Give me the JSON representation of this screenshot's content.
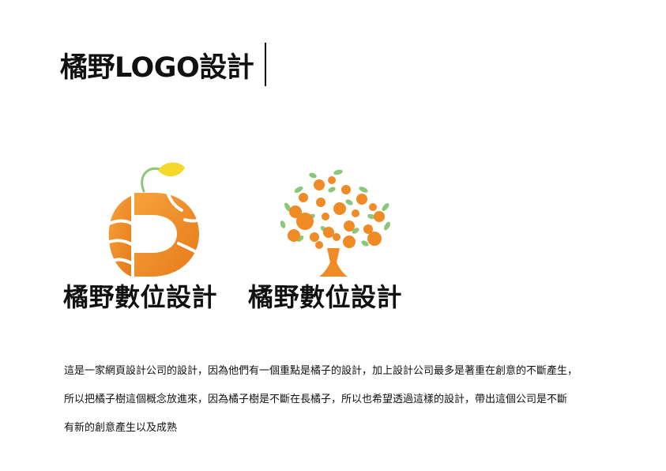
{
  "header": {
    "title": "橘野LOGO設計"
  },
  "logos": [
    {
      "caption": "橘野數位設計",
      "icon": "orange-d-icon"
    },
    {
      "caption": "橘野數位設計",
      "icon": "orange-tree-icon"
    }
  ],
  "description": {
    "lines": [
      "這是一家網頁設計公司的設計，因為他們有一個重點是橘子的設計，加上設計公司最多是著重在創意的不斷產生，",
      "所以把橘子樹這個概念放進來，因為橘子樹是不斷在長橘子，所以也希望透過這樣的設計，帶出這個公司是不斷",
      "有新的創意產生以及成熟"
    ]
  },
  "colors": {
    "orange": "#f08a24",
    "orange_light": "#f7a23c",
    "leaf_green": "#8cc67a",
    "lemon_yellow": "#f5d829",
    "text": "#111111"
  }
}
